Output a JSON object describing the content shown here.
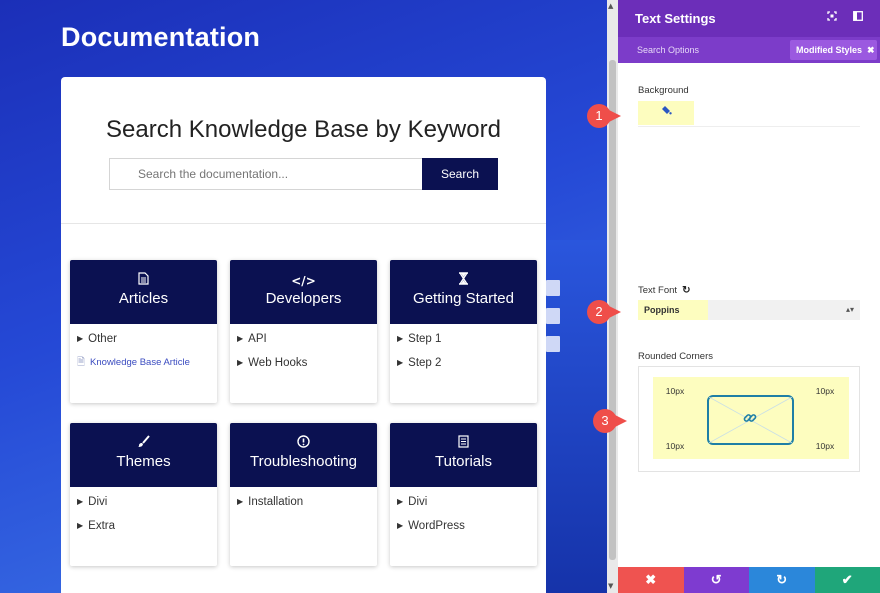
{
  "page": {
    "title": "Documentation",
    "search": {
      "heading": "Search Knowledge Base by Keyword",
      "placeholder": "Search the documentation...",
      "button_label": "Search"
    },
    "categories": [
      {
        "title": "Articles",
        "icon": "document-icon",
        "icon_glyph": "🖹",
        "items": [
          "Other"
        ],
        "article": "Knowledge Base Article"
      },
      {
        "title": "Developers",
        "icon": "code-icon",
        "icon_glyph": "</>",
        "items": [
          "API",
          "Web Hooks"
        ]
      },
      {
        "title": "Getting Started",
        "icon": "hourglass-icon",
        "icon_glyph": "⧗",
        "items": [
          "Step 1",
          "Step 2"
        ]
      },
      {
        "title": "Themes",
        "icon": "paintbrush-icon",
        "icon_glyph": "🖌",
        "items": [
          "Divi",
          "Extra"
        ]
      },
      {
        "title": "Troubleshooting",
        "icon": "alert-icon",
        "icon_glyph": "ⓘ",
        "items": [
          "Installation"
        ]
      },
      {
        "title": "Tutorials",
        "icon": "list-doc-icon",
        "icon_glyph": "☷",
        "items": [
          "Divi",
          "WordPress"
        ]
      }
    ]
  },
  "panel": {
    "title": "Text Settings",
    "tabs": {
      "search_options": "Search Options",
      "modified_styles": "Modified Styles"
    },
    "background_label": "Background",
    "text_font_label": "Text Font",
    "text_font_value": "Poppins",
    "rounded_corners_label": "Rounded Corners",
    "corners": {
      "top_left": "10px",
      "top_right": "10px",
      "bottom_left": "10px",
      "bottom_right": "10px"
    },
    "footer": [
      {
        "name": "discard",
        "icon": "close-icon",
        "glyph": "✖",
        "color": "#ef5350"
      },
      {
        "name": "undo",
        "icon": "undo-icon",
        "glyph": "↺",
        "color": "#7e3bd0"
      },
      {
        "name": "redo",
        "icon": "redo-icon",
        "glyph": "↻",
        "color": "#2b87da"
      },
      {
        "name": "save",
        "icon": "check-icon",
        "glyph": "✔",
        "color": "#1fa67a"
      }
    ]
  },
  "callouts": [
    "1",
    "2",
    "3"
  ],
  "colors": {
    "accent": "#6c2eb9",
    "navy": "#0b1151",
    "highlight": "#fdfdbf",
    "marker": "#ef4e4a"
  }
}
